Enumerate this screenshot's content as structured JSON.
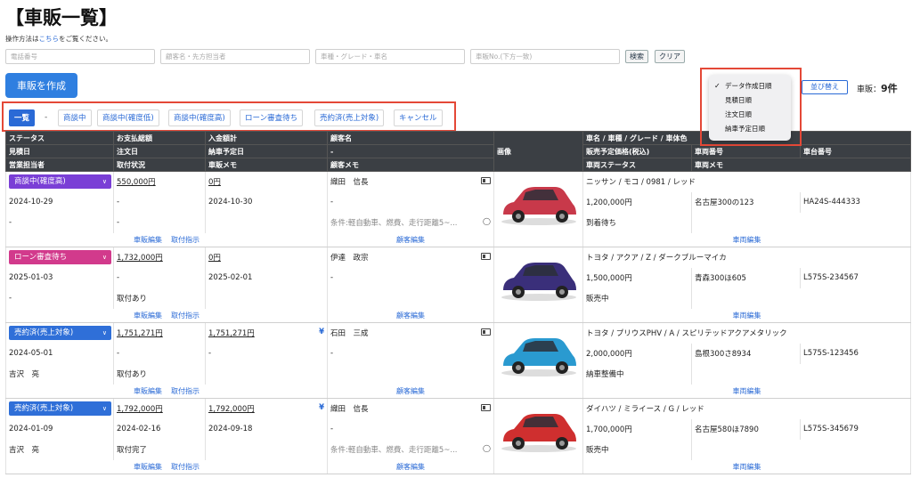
{
  "page": {
    "title": "【車販一覧】",
    "help_prefix": "操作方法は",
    "help_link": "こちら",
    "help_suffix": "をご覧ください。"
  },
  "filters": {
    "phone_placeholder": "電話番号",
    "customer_placeholder": "顧客名・先方担当者",
    "car_placeholder": "車種・グレード・車名",
    "number_placeholder": "車販No.(下方一致)",
    "search_label": "検索",
    "clear_label": "クリア"
  },
  "create_label": "車販を作成",
  "tabs": [
    {
      "label": "一覧",
      "active": true
    },
    {
      "label": "-"
    },
    {
      "label": "商談中"
    },
    {
      "label": "商談中(確度低)"
    },
    {
      "label": "商談中(確度高)"
    },
    {
      "label": "ローン審査待ち"
    },
    {
      "label": "売約済(売上対象)"
    },
    {
      "label": "キャンセル"
    }
  ],
  "sort": {
    "options": [
      "データ作成日順",
      "見積日順",
      "注文日順",
      "納車予定日順"
    ],
    "selected": "データ作成日順",
    "button_label": "並び替え",
    "count_label": "車販：",
    "count_value": "9件"
  },
  "headers": {
    "row1": [
      "ステータス",
      "お支払総額",
      "入金額計",
      "顧客名",
      "車名 / 車種 / グレード / 車体色"
    ],
    "row2": [
      "見積日",
      "注文日",
      "納車予定日",
      "-",
      "販売予定価格(税込)",
      "車両番号",
      "車台番号"
    ],
    "row3": [
      "営業担当者",
      "取付状況",
      "車販メモ",
      "顧客メモ",
      "車両ステータス",
      "車両メモ"
    ],
    "image": "画像"
  },
  "link_labels": {
    "edit_sale": "車販編集",
    "install": "取付指示",
    "edit_customer": "顧客編集",
    "edit_vehicle": "車両編集"
  },
  "rows": [
    {
      "status": "商談中(確度高)",
      "status_color": "#7a3fd6",
      "total": "550,000円",
      "paid": "0円",
      "customer": "織田　信長",
      "quote_date": "2024-10-29",
      "order_date": "-",
      "delivery_date": "2024-10-30",
      "customer_sub": "-",
      "staff": "-",
      "install": "-",
      "sale_memo": "",
      "customer_memo": "条件:軽自動車、燃費、走行距離5~...",
      "car_name": "ニッサン / モコ / 0981 / レッド",
      "price": "1,200,000円",
      "plate": "名古屋300の123",
      "chassis": "HA24S-444333",
      "vehicle_status": "到着待ち",
      "vehicle_memo": "",
      "yen": "",
      "car_color": "#c8394a"
    },
    {
      "status": "ローン審査待ち",
      "status_color": "#d23a8c",
      "total": "1,732,000円",
      "paid": "0円",
      "customer": "伊達　政宗",
      "quote_date": "2025-01-03",
      "order_date": "-",
      "delivery_date": "2025-02-01",
      "customer_sub": "-",
      "staff": "-",
      "install": "取付あり",
      "sale_memo": "",
      "customer_memo": "",
      "car_name": "トヨタ / アクア / Z / ダークブルーマイカ",
      "price": "1,500,000円",
      "plate": "青森300ほ605",
      "chassis": "L575S-234567",
      "vehicle_status": "販売中",
      "vehicle_memo": "",
      "yen": "",
      "car_color": "#3a2f7a"
    },
    {
      "status": "売約済(売上対象)",
      "status_color": "#2f6fd8",
      "total": "1,751,271円",
      "paid": "1,751,271円",
      "customer": "石田　三成",
      "quote_date": "2024-05-01",
      "order_date": "-",
      "delivery_date": "-",
      "customer_sub": "-",
      "staff": "吉沢　亮",
      "install": "取付あり",
      "sale_memo": "",
      "customer_memo": "",
      "car_name": "トヨタ / プリウスPHV / A / スピリテッドアクアメタリック",
      "price": "2,000,000円",
      "plate": "島根300さ8934",
      "chassis": "L575S-123456",
      "vehicle_status": "納車整備中",
      "vehicle_memo": "",
      "yen": "¥",
      "car_color": "#2a9ad0"
    },
    {
      "status": "売約済(売上対象)",
      "status_color": "#2f6fd8",
      "total": "1,792,000円",
      "paid": "1,792,000円",
      "customer": "織田　信長",
      "quote_date": "2024-01-09",
      "order_date": "2024-02-16",
      "delivery_date": "2024-09-18",
      "customer_sub": "-",
      "staff": "吉沢　亮",
      "install": "取付完了",
      "sale_memo": "",
      "customer_memo": "条件:軽自動車、燃費、走行距離5~...",
      "car_name": "ダイハツ / ミライース / G / レッド",
      "price": "1,700,000円",
      "plate": "名古屋580ほ7890",
      "chassis": "L575S-345679",
      "vehicle_status": "販売中",
      "vehicle_memo": "",
      "yen": "¥",
      "car_color": "#cf2f2f"
    }
  ],
  "colors": {
    "accent": "#2a6ad6",
    "header_bg": "#3b3f44",
    "highlight": "#e44837"
  }
}
